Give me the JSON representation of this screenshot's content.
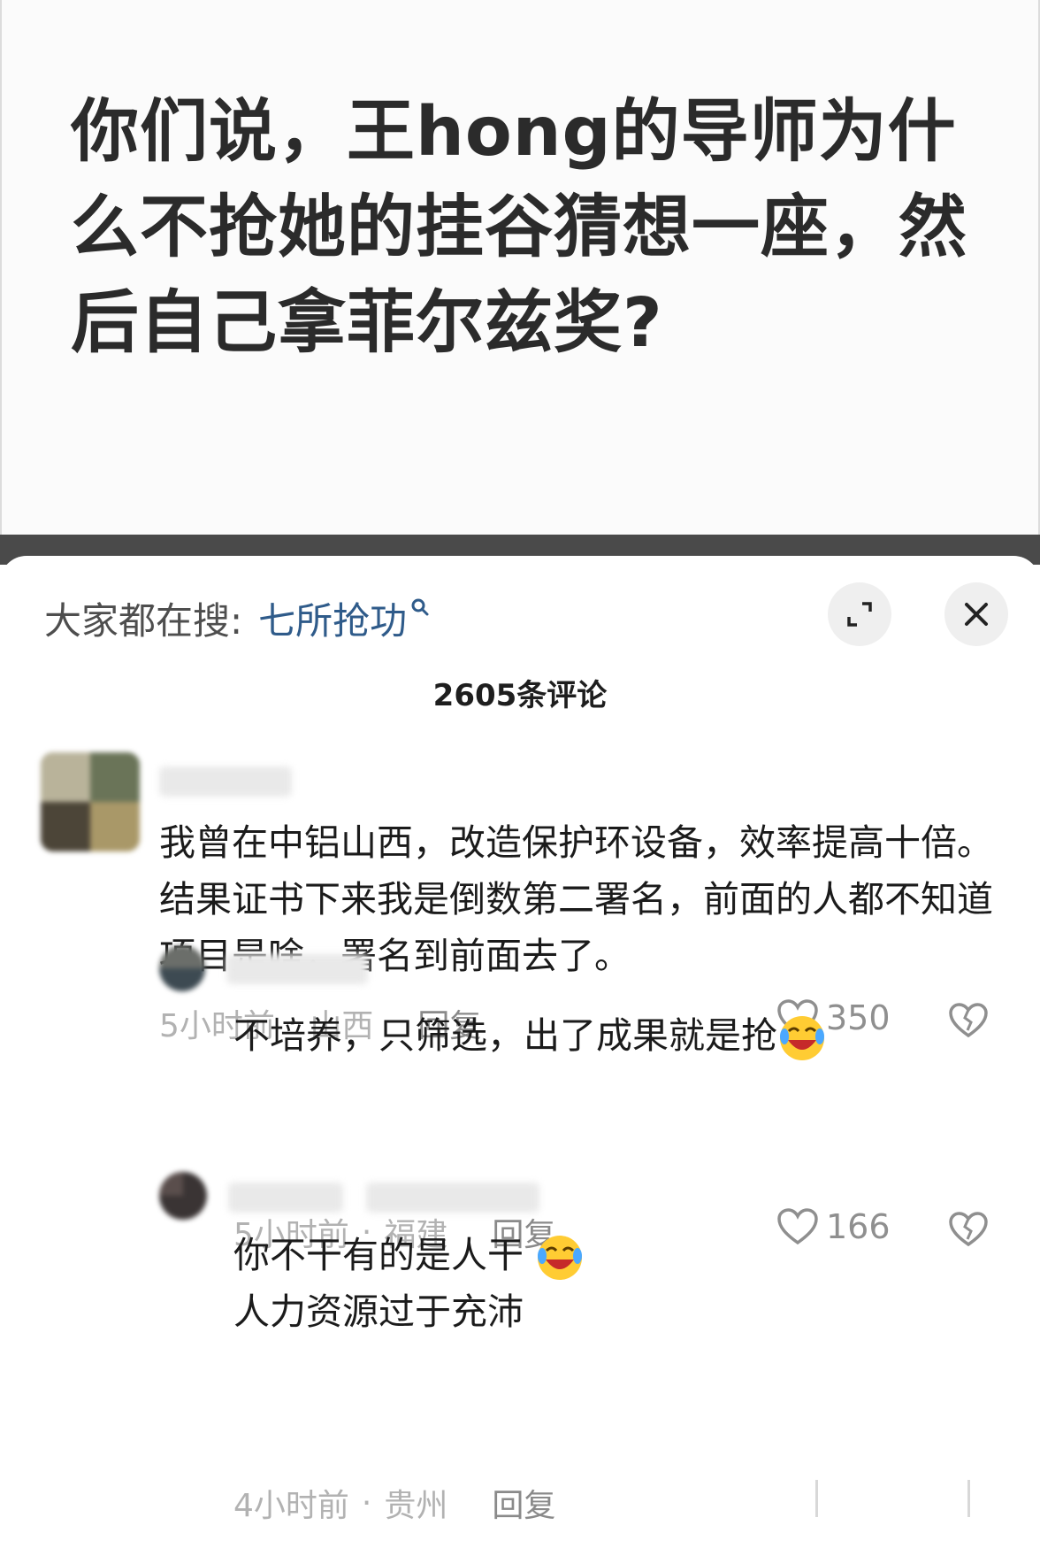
{
  "post": {
    "title": "你们说，王hong的导师为什么不抢她的挂谷猜想一座，然后自己拿菲尔兹奖?"
  },
  "sheet": {
    "search_label": "大家都在搜:",
    "search_term": "七所抢功",
    "comment_count": "2605条评论"
  },
  "comments": [
    {
      "text": "我曾在中铝山西，改造保护环设备，效率提高十倍。结果证书下来我是倒数第二署名，前面的人都不知道项目是啥，署名到前面去了。",
      "time": "5小时前",
      "location": "山西",
      "reply": "回复",
      "likes": "350"
    }
  ],
  "replies": [
    {
      "text": "不培养，只筛选，出了成果就是抢",
      "time": "5小时前",
      "location": "福建",
      "reply": "回复",
      "likes": "166"
    },
    {
      "line1": "你不干有的是人干",
      "line2": "人力资源过于充沛",
      "time": "4小时前",
      "location": "贵州",
      "reply": "回复"
    }
  ],
  "colors": {
    "accent_link": "#2f5b8a",
    "dim_band": "#4a4a4a",
    "meta_gray": "#b2b2b2"
  },
  "icons": [
    "search-icon",
    "expand-icon",
    "close-icon",
    "heart-icon",
    "broken-heart-icon",
    "laughing-crying-emoji"
  ]
}
